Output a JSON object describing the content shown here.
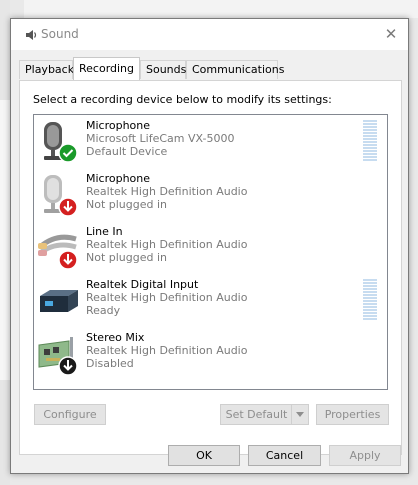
{
  "window": {
    "title": "Sound",
    "close_glyph": "✕"
  },
  "tabs": [
    {
      "label": "Playback"
    },
    {
      "label": "Recording",
      "active": true
    },
    {
      "label": "Sounds"
    },
    {
      "label": "Communications"
    }
  ],
  "instruction": "Select a recording device below to modify its settings:",
  "devices": [
    {
      "name": "Microphone",
      "driver": "Microsoft LifeCam VX-5000",
      "status": "Default Device",
      "icon": "microphone-icon",
      "badge": "default-check-icon",
      "meter": true
    },
    {
      "name": "Microphone",
      "driver": "Realtek High Definition Audio",
      "status": "Not plugged in",
      "icon": "microphone-icon",
      "badge": "unplugged-arrow-icon",
      "meter": false
    },
    {
      "name": "Line In",
      "driver": "Realtek High Definition Audio",
      "status": "Not plugged in",
      "icon": "line-in-cable-icon",
      "badge": "unplugged-arrow-icon",
      "meter": false
    },
    {
      "name": "Realtek Digital Input",
      "driver": "Realtek High Definition Audio",
      "status": "Ready",
      "icon": "digital-input-box-icon",
      "badge": null,
      "meter": true
    },
    {
      "name": "Stereo Mix",
      "driver": "Realtek High Definition Audio",
      "status": "Disabled",
      "icon": "sound-card-icon",
      "badge": "disabled-arrow-icon",
      "meter": false
    }
  ],
  "buttons": {
    "configure": "Configure",
    "set_default": "Set Default",
    "properties": "Properties",
    "ok": "OK",
    "cancel": "Cancel",
    "apply": "Apply"
  },
  "colors": {
    "check_green": "#1a9a2a",
    "unplugged_red": "#d42020",
    "disabled_black": "#1a1a1a",
    "meter_blue": "#c7dcf0"
  }
}
